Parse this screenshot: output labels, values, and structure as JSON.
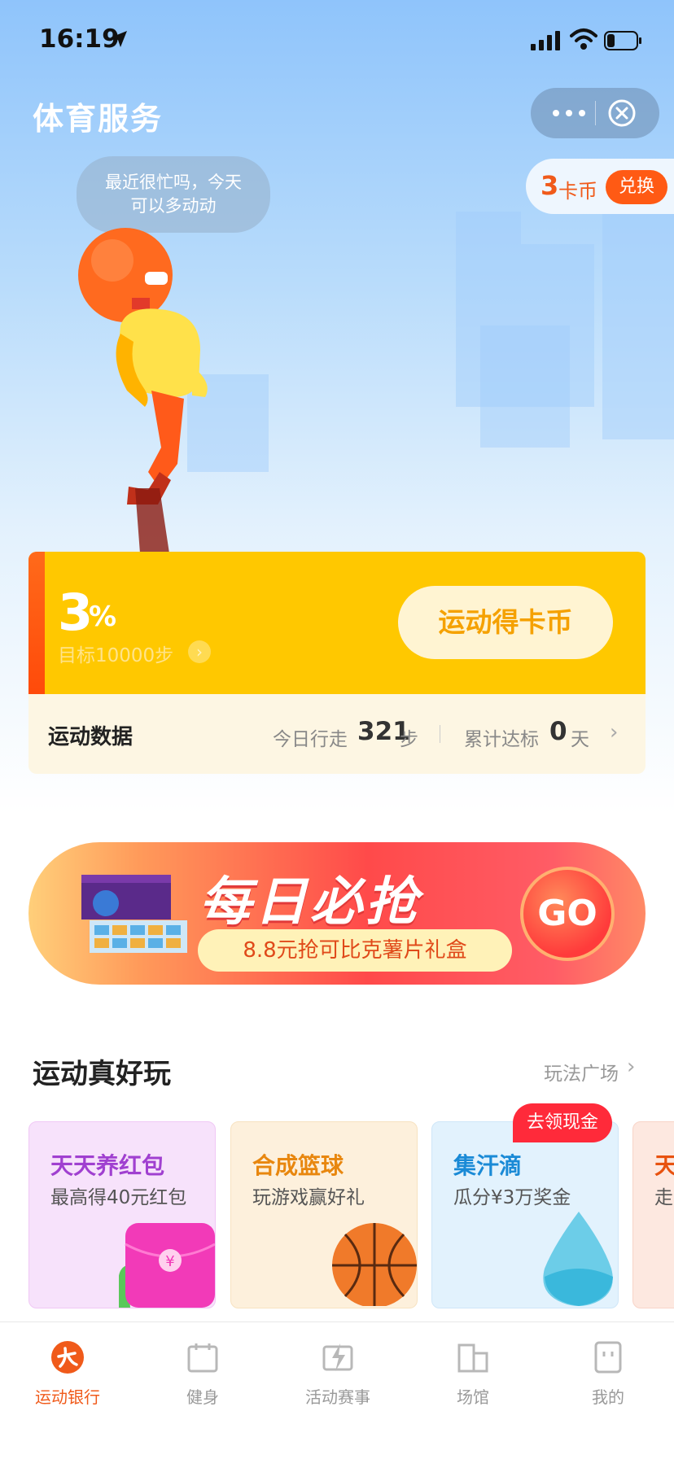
{
  "status_bar": {
    "time": "16:19"
  },
  "header": {
    "title": "体育服务"
  },
  "coins": {
    "count": "3",
    "unit": "卡币",
    "exchange_label": "兑换"
  },
  "bubble": {
    "line1": "最近很忙吗，今天",
    "line2": "可以多动动"
  },
  "goal": {
    "percent": "3",
    "percent_sign": "%",
    "progress_fraction": 0.03,
    "target_label": "目标10000步",
    "earn_button": "运动得卡币"
  },
  "sport_data": {
    "title": "运动数据",
    "today_label": "今日行走",
    "today_steps": "321",
    "today_unit": "步",
    "total_label": "累计达标",
    "total_days": "0",
    "total_unit": "天"
  },
  "banner": {
    "title": "每日必抢",
    "subtitle": "8.8元抢可比克薯片礼盒",
    "go_label": "GO"
  },
  "section": {
    "title": "运动真好玩",
    "link": "玩法广场"
  },
  "games": [
    {
      "title": "天天养红包",
      "subtitle": "最高得40元红包",
      "color": "#a040d0",
      "bg": "#f7e2fb"
    },
    {
      "title": "合成篮球",
      "subtitle": "玩游戏赢好礼",
      "color": "#e8870f",
      "bg": "#fdf0dc"
    },
    {
      "title": "集汗滴",
      "subtitle": "瓜分¥3万奖金",
      "color": "#1a8ad6",
      "bg": "#e2f2fd"
    },
    {
      "title": "天",
      "subtitle": "走",
      "color": "#e8520f",
      "bg": "#fde8e0"
    }
  ],
  "badge": {
    "label": "去领现金"
  },
  "tabbar": {
    "items": [
      {
        "label": "运动银行",
        "icon": "sport-bank-icon"
      },
      {
        "label": "健身",
        "icon": "calendar-icon"
      },
      {
        "label": "活动赛事",
        "icon": "lightning-icon"
      },
      {
        "label": "场馆",
        "icon": "building-icon"
      },
      {
        "label": "我的",
        "icon": "profile-icon"
      }
    ]
  }
}
